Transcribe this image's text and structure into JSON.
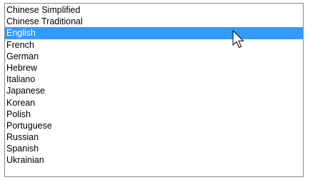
{
  "language_list": {
    "items": [
      {
        "label": "Chinese Simplified",
        "selected": false
      },
      {
        "label": "Chinese Traditional",
        "selected": false
      },
      {
        "label": "English",
        "selected": true
      },
      {
        "label": "French",
        "selected": false
      },
      {
        "label": "German",
        "selected": false
      },
      {
        "label": "Hebrew",
        "selected": false
      },
      {
        "label": "Italiano",
        "selected": false
      },
      {
        "label": "Japanese",
        "selected": false
      },
      {
        "label": "Korean",
        "selected": false
      },
      {
        "label": "Polish",
        "selected": false
      },
      {
        "label": "Portuguese",
        "selected": false
      },
      {
        "label": "Russian",
        "selected": false
      },
      {
        "label": "Spanish",
        "selected": false
      },
      {
        "label": "Ukrainian",
        "selected": false
      }
    ],
    "selected_background": "#3399ff",
    "selected_text_color": "#ffffff"
  },
  "cursor": {
    "icon": "arrow-pointer-icon"
  }
}
